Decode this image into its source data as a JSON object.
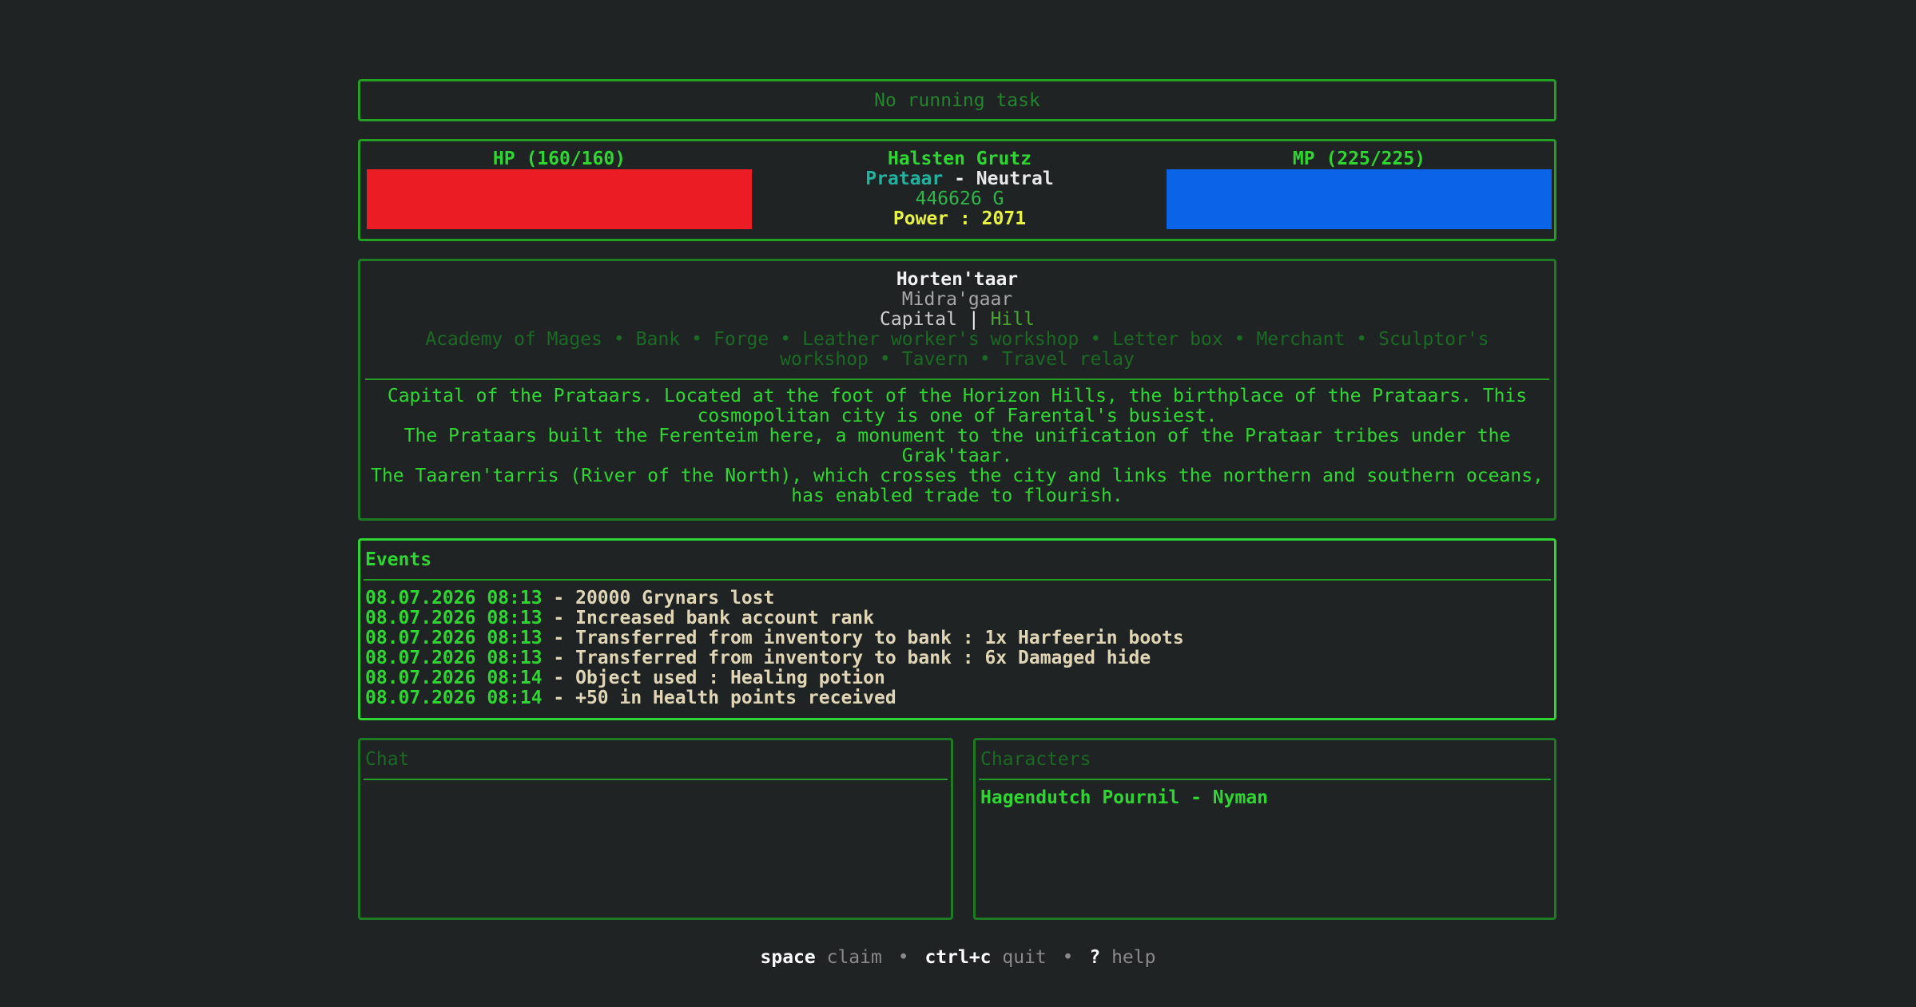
{
  "task": {
    "status": "No running task"
  },
  "status": {
    "hp": {
      "label": "HP (160/160)",
      "current": 160,
      "max": 160,
      "fill_fraction": 1.0,
      "color": "#ec1c24"
    },
    "mp": {
      "label": "MP (225/225)",
      "current": 225,
      "max": 225,
      "fill_fraction": 1.0,
      "color": "#0b64e8"
    },
    "character": {
      "name": "Halsten Grutz",
      "race": "Prataar",
      "separator": "-",
      "alignment": "Neutral",
      "gold": "446626 G",
      "power": "Power : 2071"
    }
  },
  "location": {
    "name": "Horten'taar",
    "region": "Midra'gaar",
    "type": "Capital",
    "separator": "|",
    "terrain": "Hill",
    "services": [
      "Academy of Mages",
      "Bank",
      "Forge",
      "Leather worker's workshop",
      "Letter box",
      "Merchant",
      "Sculptor's workshop",
      "Tavern",
      "Travel relay"
    ],
    "description": [
      "Capital of the Prataars. Located at the foot of the Horizon Hills, the birthplace of the Prataars. This cosmopolitan city is one of Farental's busiest.",
      "The Prataars built the Ferenteim here, a monument to the unification of the Prataar tribes under the Grak'taar.",
      "The Taaren'tarris (River of the North), which crosses the city and links the northern and southern oceans, has enabled trade to flourish."
    ]
  },
  "events": {
    "title": "Events",
    "items": [
      {
        "timestamp": "08.07.2026 08:13",
        "message": "20000 Grynars lost"
      },
      {
        "timestamp": "08.07.2026 08:13",
        "message": "Increased bank account rank"
      },
      {
        "timestamp": "08.07.2026 08:13",
        "message": "Transferred from inventory to bank : 1x Harfeerin boots"
      },
      {
        "timestamp": "08.07.2026 08:13",
        "message": "Transferred from inventory to bank : 6x Damaged hide"
      },
      {
        "timestamp": "08.07.2026 08:14",
        "message": "Object used : Healing potion"
      },
      {
        "timestamp": "08.07.2026 08:14",
        "message": "+50 in Health points received"
      }
    ]
  },
  "chat": {
    "title": "Chat"
  },
  "characters": {
    "title": "Characters",
    "items": [
      "Hagendutch Pournil - Nyman"
    ]
  },
  "help": {
    "items": [
      {
        "key": "space",
        "desc": "claim"
      },
      {
        "key": "ctrl+c",
        "desc": "quit"
      },
      {
        "key": "?",
        "desc": "help"
      }
    ],
    "separator": "•"
  }
}
